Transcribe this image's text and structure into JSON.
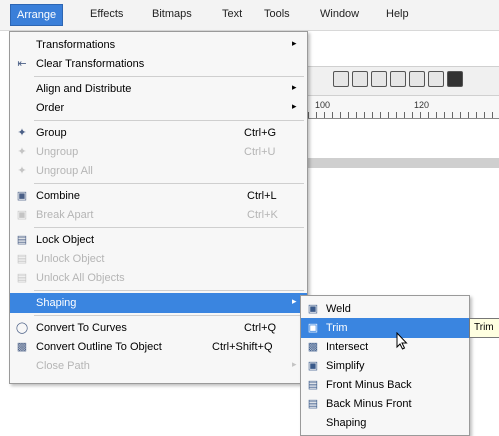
{
  "menubar": {
    "items": [
      "Arrange",
      "Effects",
      "Bitmaps",
      "Text",
      "Tools",
      "Window",
      "Help"
    ]
  },
  "ruler": {
    "labels": [
      "100",
      "120"
    ]
  },
  "arrange_menu": {
    "items": [
      {
        "label": "Transformations",
        "shortcut": "",
        "submenu": true,
        "disabled": false,
        "icon": "none"
      },
      {
        "label": "Clear Transformations",
        "shortcut": "",
        "submenu": false,
        "disabled": false,
        "icon": "clear-transformations-icon"
      },
      {
        "label": "Align and Distribute",
        "shortcut": "",
        "submenu": true,
        "disabled": false,
        "icon": "none"
      },
      {
        "label": "Order",
        "shortcut": "",
        "submenu": true,
        "disabled": false,
        "icon": "none"
      },
      {
        "label": "Group",
        "shortcut": "Ctrl+G",
        "submenu": false,
        "disabled": false,
        "icon": "group-icon"
      },
      {
        "label": "Ungroup",
        "shortcut": "Ctrl+U",
        "submenu": false,
        "disabled": true,
        "icon": "ungroup-icon"
      },
      {
        "label": "Ungroup All",
        "shortcut": "",
        "submenu": false,
        "disabled": true,
        "icon": "ungroup-all-icon"
      },
      {
        "label": "Combine",
        "shortcut": "Ctrl+L",
        "submenu": false,
        "disabled": false,
        "icon": "combine-icon"
      },
      {
        "label": "Break Apart",
        "shortcut": "Ctrl+K",
        "submenu": false,
        "disabled": true,
        "icon": "break-apart-icon"
      },
      {
        "label": "Lock Object",
        "shortcut": "",
        "submenu": false,
        "disabled": false,
        "icon": "lock-icon"
      },
      {
        "label": "Unlock Object",
        "shortcut": "",
        "submenu": false,
        "disabled": true,
        "icon": "unlock-icon"
      },
      {
        "label": "Unlock All Objects",
        "shortcut": "",
        "submenu": false,
        "disabled": true,
        "icon": "unlock-all-icon"
      },
      {
        "label": "Shaping",
        "shortcut": "",
        "submenu": true,
        "disabled": false,
        "highlighted": true,
        "icon": "none"
      },
      {
        "label": "Convert To Curves",
        "shortcut": "Ctrl+Q",
        "submenu": false,
        "disabled": false,
        "icon": "convert-curves-icon"
      },
      {
        "label": "Convert Outline To Object",
        "shortcut": "Ctrl+Shift+Q",
        "submenu": false,
        "disabled": false,
        "icon": "convert-outline-icon"
      },
      {
        "label": "Close Path",
        "shortcut": "",
        "submenu": true,
        "disabled": true,
        "icon": "none"
      }
    ]
  },
  "shaping_submenu": {
    "items": [
      {
        "label": "Weld",
        "icon": "weld-icon"
      },
      {
        "label": "Trim",
        "icon": "trim-icon",
        "highlighted": true
      },
      {
        "label": "Intersect",
        "icon": "intersect-icon"
      },
      {
        "label": "Simplify",
        "icon": "simplify-icon"
      },
      {
        "label": "Front Minus Back",
        "icon": "front-minus-back-icon"
      },
      {
        "label": "Back Minus Front",
        "icon": "back-minus-front-icon"
      },
      {
        "label": "Shaping",
        "icon": "none"
      }
    ]
  },
  "tooltip": {
    "text": "Trim"
  },
  "colors": {
    "highlight": "#3a85e0",
    "menu_bg": "#f7f7f7",
    "disabled": "#b5b5b5"
  }
}
